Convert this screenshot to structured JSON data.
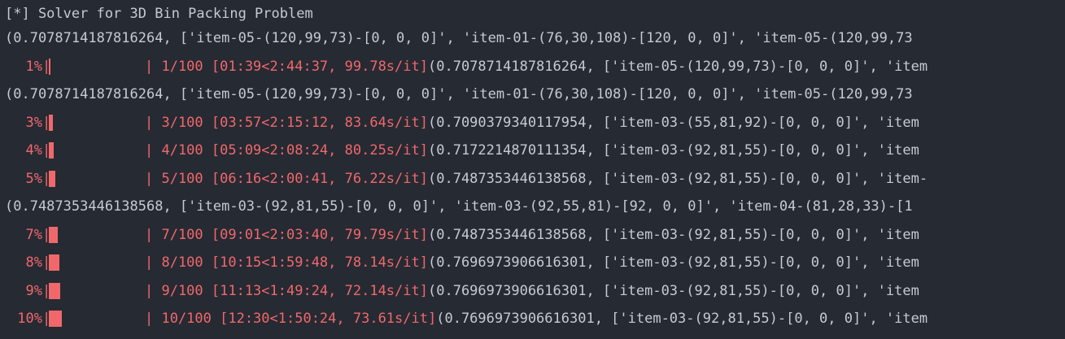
{
  "header": "[*] Solver for 3D Bin Packing Problem",
  "colors": {
    "background": "#262a33",
    "text": "#c5cad3",
    "progress": "#f0686b"
  },
  "rows": [
    {
      "kind": "text",
      "text": "(0.7078714187816264, ['item-05-(120,99,73)-[0, 0, 0]', 'item-01-(76,30,108)-[120, 0, 0]', 'item-05-(120,99,73"
    },
    {
      "kind": "progress",
      "percent": "1%",
      "fill": 0.01,
      "stats": "| 1/100 [01:39<2:44:37, 99.78s/it]",
      "tail": "(0.7078714187816264, ['item-05-(120,99,73)-[0, 0, 0]', 'item"
    },
    {
      "kind": "text",
      "text": "(0.7078714187816264, ['item-05-(120,99,73)-[0, 0, 0]', 'item-01-(76,30,108)-[120, 0, 0]', 'item-05-(120,99,73"
    },
    {
      "kind": "progress",
      "percent": "3%",
      "fill": 0.03,
      "stats": "| 3/100 [03:57<2:15:12, 83.64s/it]",
      "tail": "(0.7090379340117954, ['item-03-(55,81,92)-[0, 0, 0]', 'item"
    },
    {
      "kind": "progress",
      "percent": "4%",
      "fill": 0.04,
      "stats": "| 4/100 [05:09<2:08:24, 80.25s/it]",
      "tail": "(0.7172214870111354, ['item-03-(92,81,55)-[0, 0, 0]', 'item"
    },
    {
      "kind": "progress",
      "percent": "5%",
      "fill": 0.05,
      "stats": "| 5/100 [06:16<2:00:41, 76.22s/it]",
      "tail": "(0.7487353446138568, ['item-03-(92,81,55)-[0, 0, 0]', 'item-"
    },
    {
      "kind": "text",
      "text": "(0.7487353446138568, ['item-03-(92,81,55)-[0, 0, 0]', 'item-03-(92,55,81)-[92, 0, 0]', 'item-04-(81,28,33)-[1"
    },
    {
      "kind": "progress",
      "percent": "7%",
      "fill": 0.07,
      "stats": "| 7/100 [09:01<2:03:40, 79.79s/it]",
      "tail": "(0.7487353446138568, ['item-03-(92,81,55)-[0, 0, 0]', 'item"
    },
    {
      "kind": "progress",
      "percent": "8%",
      "fill": 0.08,
      "stats": "| 8/100 [10:15<1:59:48, 78.14s/it]",
      "tail": "(0.7696973906616301, ['item-03-(92,81,55)-[0, 0, 0]', 'item"
    },
    {
      "kind": "progress",
      "percent": "9%",
      "fill": 0.09,
      "stats": "| 9/100 [11:13<1:49:24, 72.14s/it]",
      "tail": "(0.7696973906616301, ['item-03-(92,81,55)-[0, 0, 0]', 'item"
    },
    {
      "kind": "progress",
      "percent": "10%",
      "fill": 0.1,
      "stats": "| 10/100 [12:30<1:50:24, 73.61s/it]",
      "tail": "(0.7696973906616301, ['item-03-(92,81,55)-[0, 0, 0]', 'item"
    }
  ]
}
